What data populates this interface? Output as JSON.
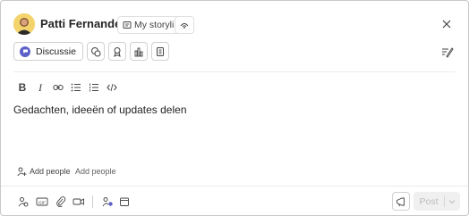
{
  "header": {
    "author_name": "Patti Fernandez",
    "storyline_chip_label": "My storyline",
    "visibility_icon": "broadcast-icon",
    "close_icon": "close-icon"
  },
  "post_type": {
    "selected_label": "Discussie",
    "type_icons": [
      "question-icon",
      "praise-icon",
      "poll-icon",
      "article-icon"
    ],
    "format_toggle_icon": "compose-format-icon"
  },
  "formatting_toolbar": {
    "bold_label": "B",
    "italic_label": "I",
    "items": [
      "bold-icon",
      "italic-icon",
      "link-icon",
      "bullet-list-icon",
      "numbered-list-icon",
      "code-icon"
    ]
  },
  "composer": {
    "placeholder": "Gedachten, ideeën of updates delen"
  },
  "people": {
    "add_people_label": "Add people",
    "add_people_hint": "Add people"
  },
  "bottom_toolbar": {
    "items": [
      "add-people-icon",
      "gif-icon",
      "attach-icon",
      "video-icon",
      "teams-icon",
      "calendar-icon"
    ],
    "announce_icon": "megaphone-icon",
    "post_label": "Post",
    "post_options_icon": "chevron-down-icon"
  },
  "colors": {
    "accent": "#5b5fc7",
    "text": "#242424",
    "disabled_text": "#bdbdbd",
    "border": "#d1d1d1"
  }
}
